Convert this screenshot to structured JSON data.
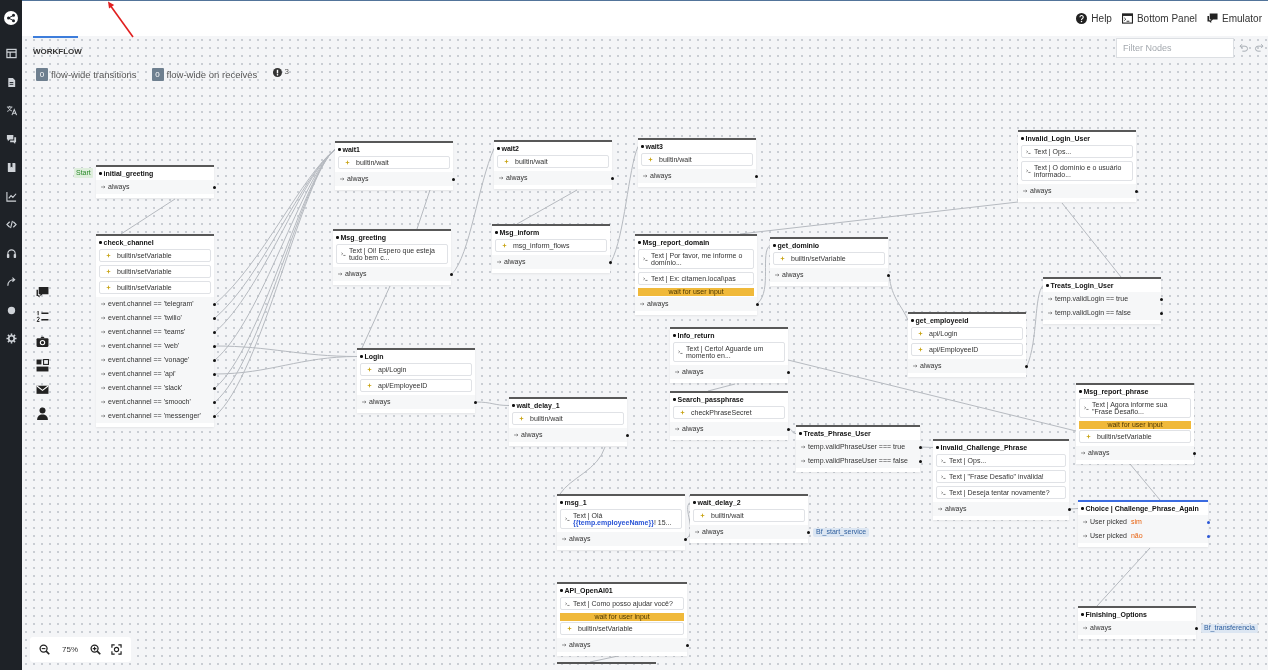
{
  "header": {
    "links": [
      "Help",
      "Bottom Panel",
      "Emulator"
    ]
  },
  "tabs": [
    {
      "label": "WORKFLOW",
      "selected": true
    }
  ],
  "filter": {
    "placeholder": "Filter Nodes"
  },
  "counters": [
    {
      "count": "0",
      "label": "flow-wide transitions"
    },
    {
      "count": "0",
      "label": "flow-wide on receives"
    }
  ],
  "issues": {
    "count": "3"
  },
  "nodes": [
    {
      "name": "initial_greeting",
      "kind": "standard",
      "start_label": "Start",
      "items": [
        {
          "kind": "transition",
          "text": "always"
        }
      ]
    },
    {
      "name": "wait1",
      "kind": "standard",
      "items": [
        {
          "kind": "skill",
          "text": "builtin/wait"
        },
        {
          "kind": "transition",
          "text": "always"
        }
      ]
    },
    {
      "name": "wait2",
      "kind": "standard",
      "items": [
        {
          "kind": "skill",
          "text": "builtin/wait"
        },
        {
          "kind": "transition",
          "text": "always"
        }
      ]
    },
    {
      "name": "wait3",
      "kind": "standard",
      "items": [
        {
          "kind": "skill",
          "text": "builtin/wait"
        },
        {
          "kind": "transition",
          "text": "always"
        }
      ]
    },
    {
      "name": "Invalid_Login_User",
      "kind": "standard",
      "items": [
        {
          "kind": "message",
          "text": "Text | Ops..."
        },
        {
          "kind": "message",
          "text": "Text | O domínio e o usuário informado..."
        },
        {
          "kind": "transition",
          "text": "always"
        }
      ]
    },
    {
      "name": "check_channel",
      "kind": "standard",
      "items": [
        {
          "kind": "skill",
          "text": "builtin/setVariable"
        },
        {
          "kind": "skill",
          "text": "builtin/setVariable"
        },
        {
          "kind": "skill",
          "text": "builtin/setVariable"
        },
        {
          "kind": "transition",
          "text": "event.channel == 'telegram'"
        },
        {
          "kind": "transition",
          "text": "event.channel == 'twilio'"
        },
        {
          "kind": "transition",
          "text": "event.channel == 'teams'"
        },
        {
          "kind": "transition",
          "text": "event.channel == 'web'"
        },
        {
          "kind": "transition",
          "text": "event.channel == 'vonage'"
        },
        {
          "kind": "transition",
          "text": "event.channel == 'api'"
        },
        {
          "kind": "transition",
          "text": "event.channel == 'slack'"
        },
        {
          "kind": "transition",
          "text": "event.channel == 'smooch'"
        },
        {
          "kind": "transition",
          "text": "event.channel == 'messenger'"
        }
      ]
    },
    {
      "name": "Msg_greeting",
      "kind": "standard",
      "items": [
        {
          "kind": "message",
          "text": "Text | Oi! Espero que esteja tudo bem c..."
        },
        {
          "kind": "transition",
          "text": "always"
        }
      ]
    },
    {
      "name": "Msg_inform",
      "kind": "standard",
      "items": [
        {
          "kind": "skill",
          "text": "msg_inform_flows"
        },
        {
          "kind": "transition",
          "text": "always"
        }
      ]
    },
    {
      "name": "Msg_report_domain",
      "kind": "standard",
      "items": [
        {
          "kind": "message",
          "text": "Text | Por favor, me informe o domínio..."
        },
        {
          "kind": "message",
          "text": "Text | Ex: citamen.local\\pas"
        },
        {
          "kind": "wait",
          "text": "wait for user input"
        },
        {
          "kind": "transition",
          "text": "always"
        }
      ]
    },
    {
      "name": "get_dominio",
      "kind": "standard",
      "items": [
        {
          "kind": "skill",
          "text": "builtin/setVariable"
        },
        {
          "kind": "transition",
          "text": "always"
        }
      ]
    },
    {
      "name": "Login",
      "kind": "standard",
      "items": [
        {
          "kind": "skill",
          "text": "api/Login"
        },
        {
          "kind": "skill",
          "text": "api/EmployeeID"
        },
        {
          "kind": "transition",
          "text": "always"
        }
      ]
    },
    {
      "name": "Info_return",
      "kind": "standard",
      "items": [
        {
          "kind": "message",
          "text": "Text | Certo! Aguarde um momento en..."
        },
        {
          "kind": "transition",
          "text": "always"
        }
      ]
    },
    {
      "name": "get_employeeid",
      "kind": "standard",
      "items": [
        {
          "kind": "skill",
          "text": "api/Login"
        },
        {
          "kind": "skill",
          "text": "api/EmployeeID"
        },
        {
          "kind": "transition",
          "text": "always"
        }
      ]
    },
    {
      "name": "Treats_Login_User",
      "kind": "standard",
      "items": [
        {
          "kind": "transition",
          "text": "temp.validLogin == true"
        },
        {
          "kind": "transition",
          "text": "temp.validLogin == false"
        }
      ]
    },
    {
      "name": "wait_delay_1",
      "kind": "standard",
      "items": [
        {
          "kind": "skill",
          "text": "builtin/wait"
        },
        {
          "kind": "transition",
          "text": "always"
        }
      ]
    },
    {
      "name": "Search_passphrase",
      "kind": "standard",
      "items": [
        {
          "kind": "skill",
          "text": "checkPhraseSecret"
        },
        {
          "kind": "transition",
          "text": "always"
        }
      ]
    },
    {
      "name": "Treats_Phrase_User",
      "kind": "standard",
      "items": [
        {
          "kind": "transition",
          "text": "temp.validPhraseUser === true"
        },
        {
          "kind": "transition",
          "text": "temp.validPhraseUser === false"
        }
      ]
    },
    {
      "name": "Invalid_Challenge_Phrase",
      "kind": "standard",
      "items": [
        {
          "kind": "message",
          "text": "Text | Ops..."
        },
        {
          "kind": "message",
          "text": "Text | \"Frase Desafio\" inválida!"
        },
        {
          "kind": "message",
          "text": "Text | Deseja tentar novamente?"
        },
        {
          "kind": "transition",
          "text": "always"
        }
      ]
    },
    {
      "name": "Msg_report_phrase",
      "kind": "standard",
      "items": [
        {
          "kind": "message",
          "text": "Text | Agora informe sua \"Frase Desafio..."
        },
        {
          "kind": "wait",
          "text": "wait for user input"
        },
        {
          "kind": "skill",
          "text": "builtin/setVariable"
        },
        {
          "kind": "transition",
          "text": "always"
        }
      ]
    },
    {
      "name": "msg_1",
      "kind": "standard",
      "items": [
        {
          "kind": "message",
          "text": "Text | Olá **{{temp.employeeName}}**! 15..."
        },
        {
          "kind": "transition",
          "text": "always"
        }
      ]
    },
    {
      "name": "wait_delay_2",
      "kind": "standard",
      "items": [
        {
          "kind": "skill",
          "text": "builtin/wait"
        },
        {
          "kind": "transition",
          "text": "always",
          "target": "Bf_start_service"
        }
      ]
    },
    {
      "name": "Choice | Challenge_Phrase_Again",
      "kind": "choice",
      "items": [
        {
          "kind": "choice",
          "label": "User picked",
          "value": "sim"
        },
        {
          "kind": "choice",
          "label": "User picked",
          "value": "não"
        }
      ]
    },
    {
      "name": "API_OpenAI01",
      "kind": "standard",
      "items": [
        {
          "kind": "message",
          "text": "Text | Como posso ajudar você?"
        },
        {
          "kind": "wait",
          "text": "wait for user input"
        },
        {
          "kind": "skill",
          "text": "builtin/setVariable"
        },
        {
          "kind": "transition",
          "text": "always"
        }
      ]
    },
    {
      "name": "Finishing_Options",
      "kind": "standard",
      "items": [
        {
          "kind": "transition",
          "text": "always",
          "target": "Bf_transferencia"
        }
      ]
    }
  ],
  "zoom": {
    "value": "75%"
  }
}
